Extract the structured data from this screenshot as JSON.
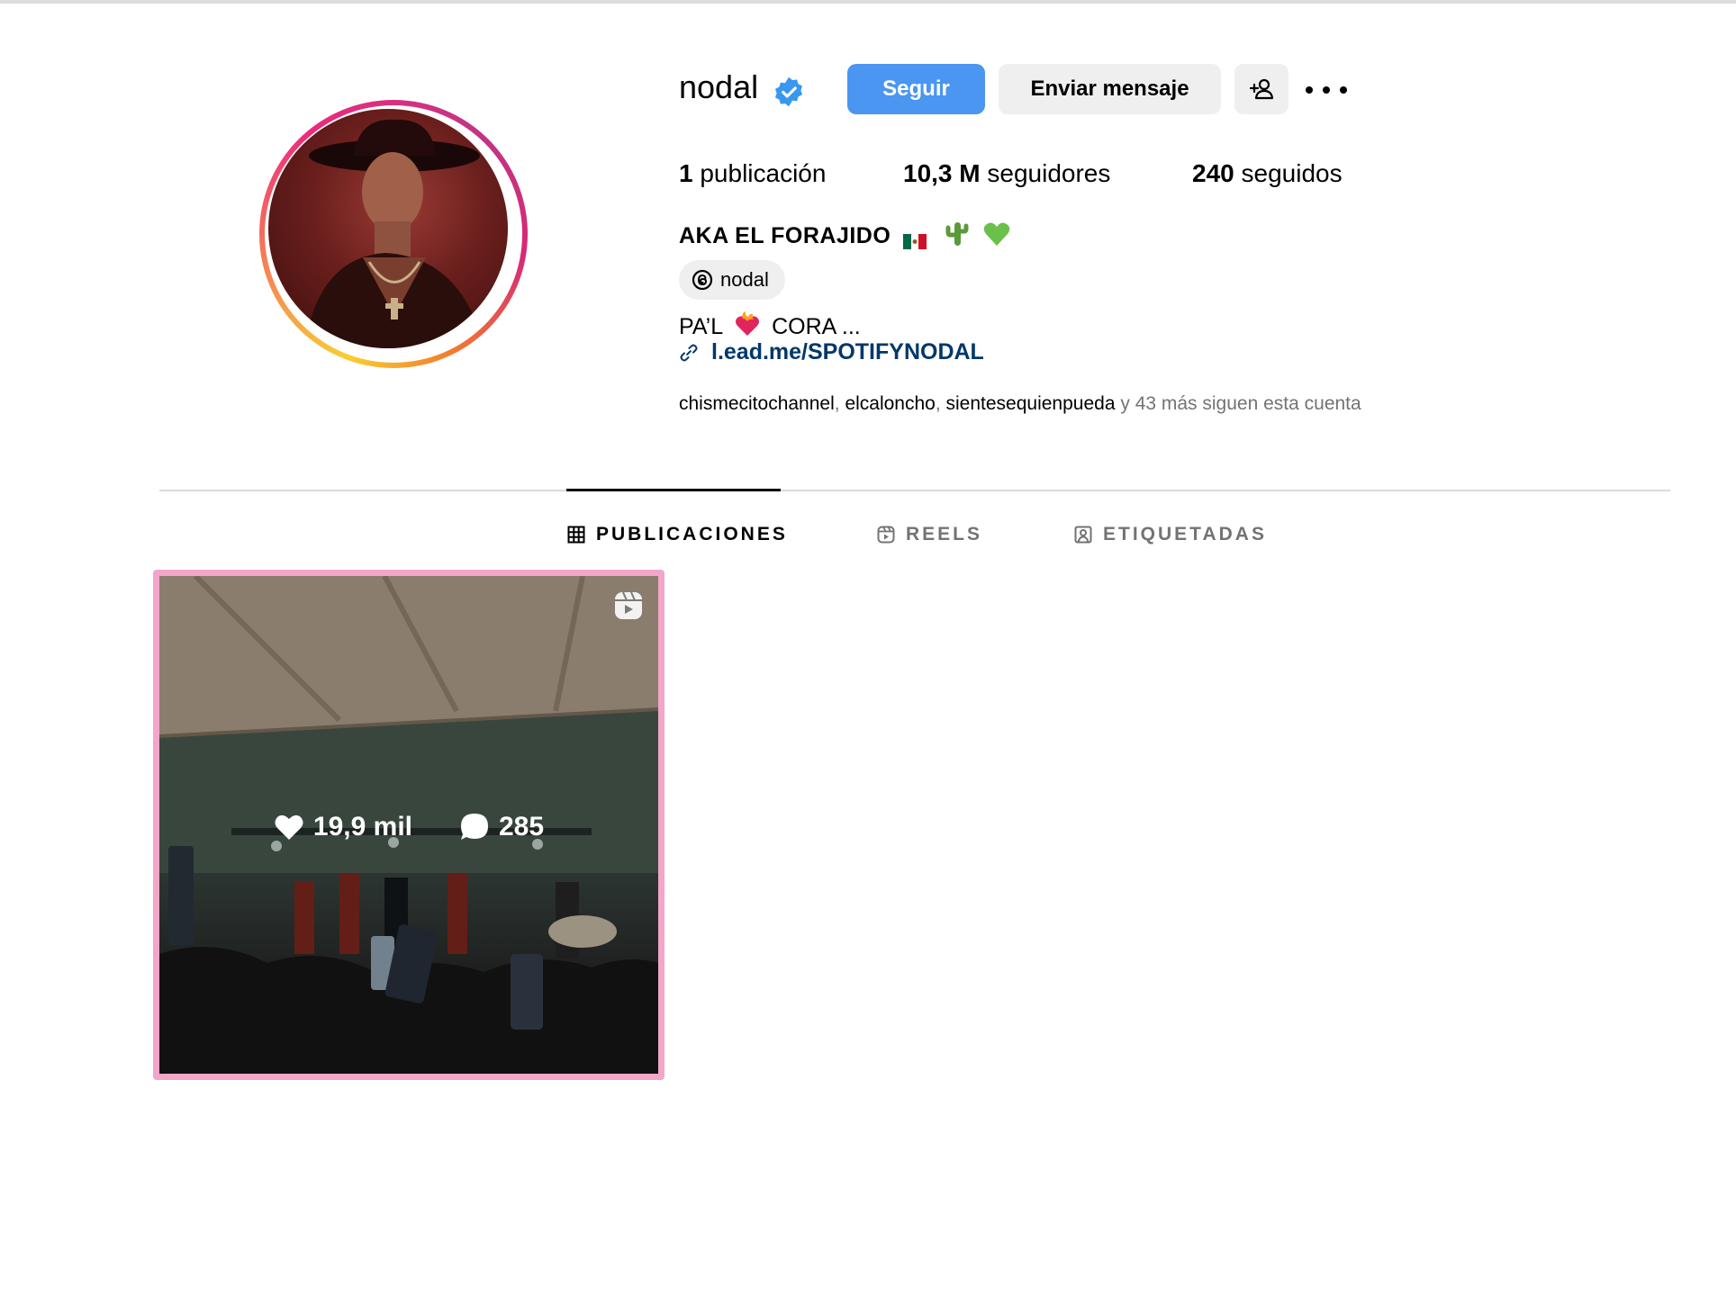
{
  "profile": {
    "username": "nodal",
    "verified_icon": "verified-badge-icon",
    "full_name": "AKA EL FORAJIDO",
    "threads_handle": "nodal",
    "bio_prefix": "PA’L",
    "bio_suffix": "CORA ...",
    "link": "l.ead.me/SPOTIFYNODAL"
  },
  "actions": {
    "follow_label": "Seguir",
    "message_label": "Enviar mensaje"
  },
  "stats": {
    "posts_count": "1",
    "posts_label": "publicación",
    "followers_count": "10,3 M",
    "followers_label": "seguidores",
    "following_count": "240",
    "following_label": "seguidos"
  },
  "followed_by": {
    "names": [
      "chismecitochannel",
      "elcaloncho",
      "sientesequienpueda"
    ],
    "suffix": "y 43 más siguen esta cuenta"
  },
  "tabs": [
    {
      "label": "PUBLICACIONES",
      "icon": "grid-icon",
      "active": true
    },
    {
      "label": "REELS",
      "icon": "reels-icon",
      "active": false
    },
    {
      "label": "ETIQUETADAS",
      "icon": "tagged-icon",
      "active": false
    }
  ],
  "posts": [
    {
      "likes": "19,9 mil",
      "comments": "285",
      "type": "reel"
    }
  ],
  "colors": {
    "follow_button": "#4a96f0",
    "link": "#00376b",
    "secondary_text": "#737373",
    "hover_frame": "#f2a6c8"
  }
}
